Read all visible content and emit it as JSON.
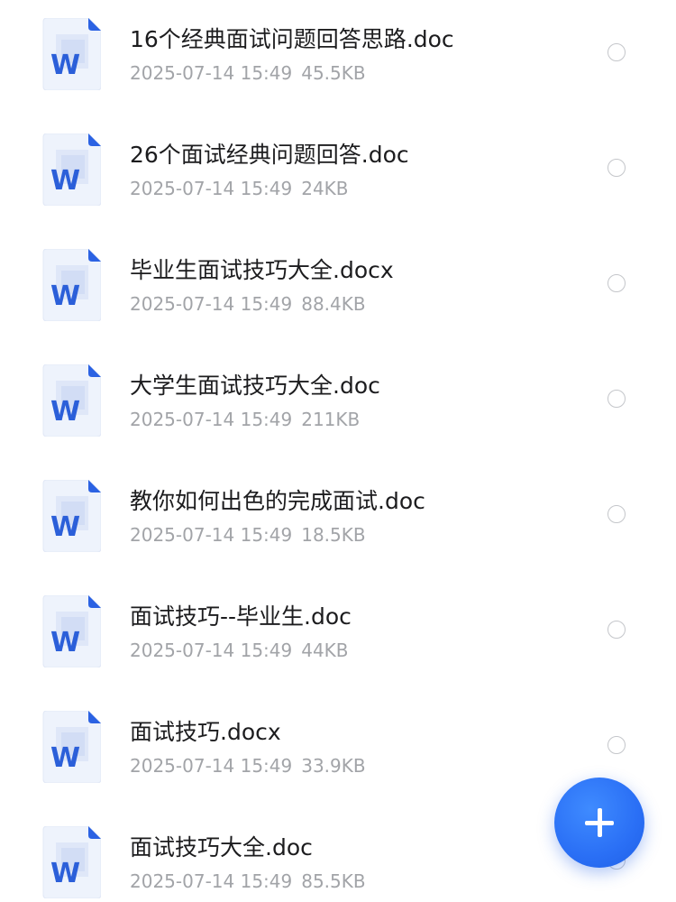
{
  "files": [
    {
      "name": "16个经典面试问题回答思路.doc",
      "date": "2025-07-14 15:49",
      "size": "45.5KB",
      "icon": "word-doc-icon"
    },
    {
      "name": "26个面试经典问题回答.doc",
      "date": "2025-07-14 15:49",
      "size": "24KB",
      "icon": "word-doc-icon"
    },
    {
      "name": "毕业生面试技巧大全.docx",
      "date": "2025-07-14 15:49",
      "size": "88.4KB",
      "icon": "word-doc-icon"
    },
    {
      "name": "大学生面试技巧大全.doc",
      "date": "2025-07-14 15:49",
      "size": "211KB",
      "icon": "word-doc-icon"
    },
    {
      "name": "教你如何出色的完成面试.doc",
      "date": "2025-07-14 15:49",
      "size": "18.5KB",
      "icon": "word-doc-icon"
    },
    {
      "name": "面试技巧--毕业生.doc",
      "date": "2025-07-14 15:49",
      "size": "44KB",
      "icon": "word-doc-icon"
    },
    {
      "name": "面试技巧.docx",
      "date": "2025-07-14 15:49",
      "size": "33.9KB",
      "icon": "word-doc-icon"
    },
    {
      "name": "面试技巧大全.doc",
      "date": "2025-07-14 15:49",
      "size": "85.5KB",
      "icon": "word-doc-icon"
    }
  ],
  "fab": {
    "icon": "plus-icon"
  },
  "colors": {
    "accent": "#2a6ff5",
    "word_blue": "#2b5fd9",
    "meta_gray": "#a2a4a8"
  }
}
